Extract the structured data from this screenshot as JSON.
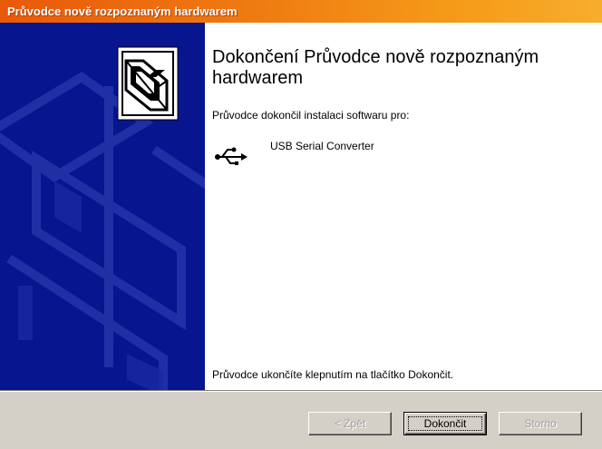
{
  "window": {
    "title": "Průvodce nově rozpoznaným hardwarem"
  },
  "content": {
    "heading": "Dokončení Průvodce nově rozpoznaným hardwarem",
    "intro": "Průvodce dokončil instalaci softwaru pro:",
    "device": {
      "name": "USB Serial Converter",
      "icon": "usb-icon"
    },
    "finish_hint": "Průvodce ukončíte klepnutím na tlačítko Dokončit."
  },
  "buttons": {
    "back": {
      "label": "< Zpět",
      "enabled": false
    },
    "finish": {
      "label": "Dokončit",
      "enabled": true
    },
    "cancel": {
      "label": "Storno",
      "enabled": false
    }
  },
  "colors": {
    "title_bar": "#ef7d12",
    "wizard_panel": "#07158f",
    "footer": "#d4d0c8"
  }
}
